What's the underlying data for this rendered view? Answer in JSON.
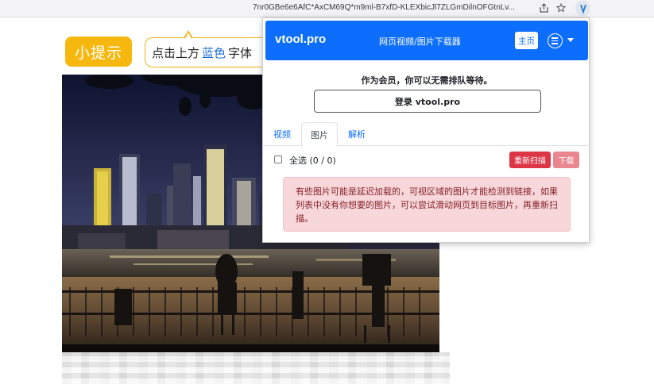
{
  "browser": {
    "url": "7nr0GBe6e6AfC*AxCM69Q*m9ml-B7xfD-KLEXbicJl7ZLGmDilnOFGtnLv...",
    "share_icon": "share-icon",
    "bookmark_icon": "star-icon",
    "extension_icon": "vtool-extension-icon"
  },
  "page": {
    "hint_badge": "小提示",
    "hint_text_before": "点击上方",
    "hint_text_blue": "蓝色",
    "hint_text_after": "字体",
    "photo_icon": "night-skyline-photo"
  },
  "popup": {
    "brand": "vtool.pro",
    "subtitle": "网页视频/图片下载器",
    "home_label": "主页",
    "menu_icon": "list-circle-icon",
    "member_text": "作为会员，你可以无需排队等待。",
    "login_label": "登录 vtool.pro",
    "tabs": [
      {
        "label": "视频",
        "active": false
      },
      {
        "label": "图片",
        "active": true
      },
      {
        "label": "解析",
        "active": false
      }
    ],
    "select_all_label": "全选 (0 / 0)",
    "select_all_checked": false,
    "rescan_label": "重新扫描",
    "download_label": "下载",
    "alert_text": "有些图片可能是延迟加载的，可视区域的图片才能检测到链接，如果列表中没有你想要的图片，可以尝试滑动网页到目标图片，再重新扫描。"
  },
  "colors": {
    "primary": "#0d6efd",
    "danger": "#dc3545",
    "danger_light": "#e9868f",
    "alert_bg": "#f8d7da",
    "alert_text": "#842029",
    "hint_yellow": "#f6b80e",
    "hint_blue": "#1a6fd3"
  }
}
